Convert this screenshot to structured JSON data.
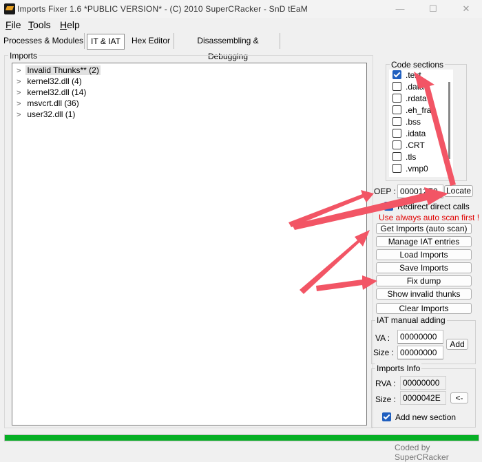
{
  "window": {
    "title": "Imports Fixer 1.6 *PUBLIC VERSION* - (C) 2010 SuperCRacker - SnD tEaM",
    "minimize_glyph": "—",
    "maximize_glyph": "☐",
    "close_glyph": "✕"
  },
  "menu": {
    "file": {
      "u": "F",
      "rest": "ile"
    },
    "tools": {
      "u": "T",
      "rest": "ools"
    },
    "help": {
      "u": "H",
      "rest": "elp"
    }
  },
  "tabs": [
    {
      "label": "Processes & Modules",
      "active": false
    },
    {
      "label": "IT & IAT",
      "active": true
    },
    {
      "label": "Hex Editor",
      "active": false
    },
    {
      "label": "Disassembling & Debugging",
      "active": false
    }
  ],
  "imports": {
    "group_label": "Imports",
    "tree": [
      {
        "label": "Invalid Thunks** (2)",
        "selected": true
      },
      {
        "label": "kernel32.dll (4)",
        "selected": false
      },
      {
        "label": "kernel32.dll (14)",
        "selected": false
      },
      {
        "label": "msvcrt.dll (36)",
        "selected": false
      },
      {
        "label": "user32.dll (1)",
        "selected": false
      }
    ]
  },
  "code_sections": {
    "label": "Code sections",
    "items": [
      {
        "label": ".text",
        "checked": true
      },
      {
        "label": ".data",
        "checked": false
      },
      {
        "label": ".rdata",
        "checked": false
      },
      {
        "label": ".eh_fra",
        "checked": false
      },
      {
        "label": ".bss",
        "checked": false
      },
      {
        "label": ".idata",
        "checked": false
      },
      {
        "label": ".CRT",
        "checked": false
      },
      {
        "label": ".tls",
        "checked": false
      },
      {
        "label": ".vmp0",
        "checked": false
      }
    ]
  },
  "oep": {
    "label": "OEP :",
    "value": "000012E0",
    "locate": "Locate"
  },
  "redirect": {
    "label": "Redirect direct calls",
    "checked": true
  },
  "hint": "Use always auto scan first !",
  "buttons": {
    "get_imports": "Get Imports (auto scan)",
    "manage_iat": "Manage IAT entries",
    "load_imports": "Load Imports",
    "save_imports": "Save Imports",
    "fix_dump": "Fix dump",
    "show_invalid": "Show invalid thunks",
    "clear_imports": "Clear Imports"
  },
  "iat_manual": {
    "label": "IAT manual adding",
    "va_label": "VA :",
    "va_value": "00000000",
    "size_label": "Size :",
    "size_value": "00000000",
    "add": "Add"
  },
  "imports_info": {
    "label": "Imports Info",
    "rva_label": "RVA :",
    "rva_value": "00000000",
    "size_label": "Size :",
    "size_value": "0000042E",
    "arrow_btn": "<-",
    "add_section_label": "Add new section",
    "add_section_checked": true
  },
  "progress": {
    "fraction": 1.0,
    "color": "#06b025"
  },
  "status": {
    "coded_by": "Coded by SuperCRacker"
  },
  "annotation_color": "#f25565"
}
